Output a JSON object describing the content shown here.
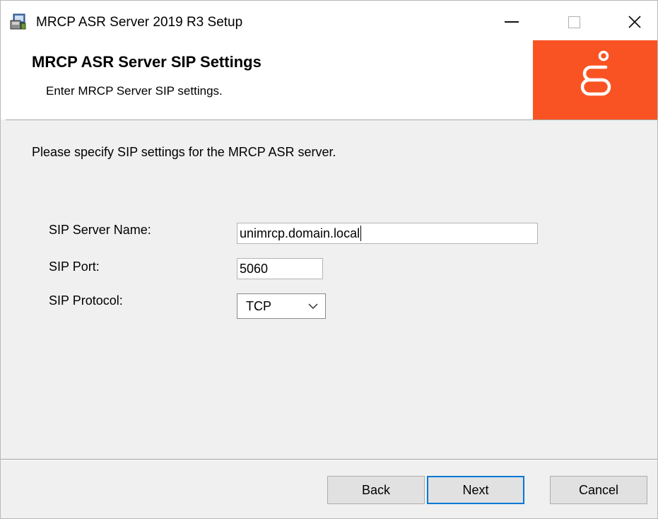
{
  "window": {
    "title": "MRCP ASR Server 2019 R3 Setup"
  },
  "banner": {
    "title": "MRCP ASR Server SIP Settings",
    "subtitle": "Enter MRCP Server SIP settings.",
    "logo_color": "#fa5323"
  },
  "form": {
    "intro": "Please specify SIP settings for the MRCP ASR server.",
    "server_name": {
      "label": "SIP Server Name:",
      "value": "unimrcp.domain.local"
    },
    "port": {
      "label": "SIP Port:",
      "value": "5060"
    },
    "protocol": {
      "label": "SIP Protocol:",
      "value": "TCP"
    }
  },
  "buttons": {
    "back": "Back",
    "next": "Next",
    "cancel": "Cancel"
  },
  "colors": {
    "accent": "#0078d7",
    "dialog_bg": "#f0f0f0"
  }
}
